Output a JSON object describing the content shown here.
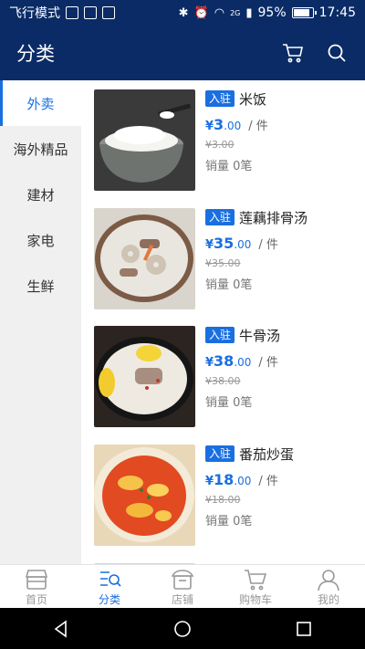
{
  "statusbar": {
    "airplane_label": "飞行模式",
    "battery_text": "95%",
    "battery_level": 0.95,
    "time": "17:45",
    "network_label": "2G"
  },
  "header": {
    "title": "分类",
    "icons": [
      "cart-icon",
      "search-icon"
    ]
  },
  "categories": [
    {
      "label": "外卖",
      "active": true
    },
    {
      "label": "海外精品",
      "active": false
    },
    {
      "label": "建材",
      "active": false
    },
    {
      "label": "家电",
      "active": false
    },
    {
      "label": "生鲜",
      "active": false
    }
  ],
  "products": [
    {
      "badge": "入驻",
      "name": "米饭",
      "currency": "¥",
      "price_int": "3",
      "price_dec": ".00",
      "unit": "/ 件",
      "orig_price": "¥3.00",
      "sales": "销量 0笔"
    },
    {
      "badge": "入驻",
      "name": "莲藕排骨汤",
      "currency": "¥",
      "price_int": "35",
      "price_dec": ".00",
      "unit": "/ 件",
      "orig_price": "¥35.00",
      "sales": "销量 0笔"
    },
    {
      "badge": "入驻",
      "name": "牛骨汤",
      "currency": "¥",
      "price_int": "38",
      "price_dec": ".00",
      "unit": "/ 件",
      "orig_price": "¥38.00",
      "sales": "销量 0笔"
    },
    {
      "badge": "入驻",
      "name": "番茄炒蛋",
      "currency": "¥",
      "price_int": "18",
      "price_dec": ".00",
      "unit": "/ 件",
      "orig_price": "¥18.00",
      "sales": "销量 0笔"
    }
  ],
  "tabs": [
    {
      "label": "首页",
      "icon": "home-shop-icon",
      "active": false
    },
    {
      "label": "分类",
      "icon": "category-icon",
      "active": true
    },
    {
      "label": "店铺",
      "icon": "store-icon",
      "active": false
    },
    {
      "label": "购物车",
      "icon": "cart-icon",
      "active": false
    },
    {
      "label": "我的",
      "icon": "user-icon",
      "active": false
    }
  ],
  "colors": {
    "primary": "#0a2b66",
    "accent": "#1a6fe0"
  }
}
